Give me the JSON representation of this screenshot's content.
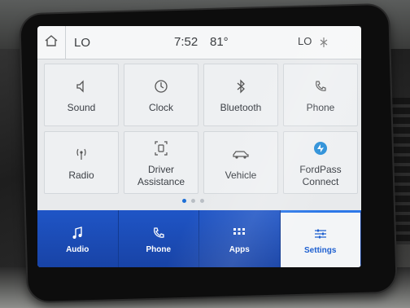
{
  "status_bar": {
    "left_climate": "LO",
    "time": "7:52",
    "temperature": "81°",
    "right_climate": "LO"
  },
  "tiles": [
    {
      "label": "Sound",
      "icon": "speaker-icon"
    },
    {
      "label": "Clock",
      "icon": "clock-icon"
    },
    {
      "label": "Bluetooth",
      "icon": "bluetooth-icon"
    },
    {
      "label": "Phone",
      "icon": "phone-icon"
    },
    {
      "label": "Radio",
      "icon": "radio-antenna-icon"
    },
    {
      "label": "Driver Assistance",
      "icon": "driver-assist-icon"
    },
    {
      "label": "Vehicle",
      "icon": "car-icon"
    },
    {
      "label": "FordPass Connect",
      "icon": "fordpass-icon"
    }
  ],
  "page_indicator": {
    "current": 1,
    "total": 3
  },
  "bottom_nav": [
    {
      "label": "Audio",
      "icon": "music-note-icon",
      "active": false
    },
    {
      "label": "Phone",
      "icon": "phone-icon",
      "active": false
    },
    {
      "label": "Apps",
      "icon": "apps-grid-icon",
      "active": false
    },
    {
      "label": "Settings",
      "icon": "sliders-icon",
      "active": true
    }
  ],
  "colors": {
    "nav_blue": "#1744a8",
    "accent_blue": "#2d78e8",
    "fordpass_blue": "#2a8fd8"
  }
}
